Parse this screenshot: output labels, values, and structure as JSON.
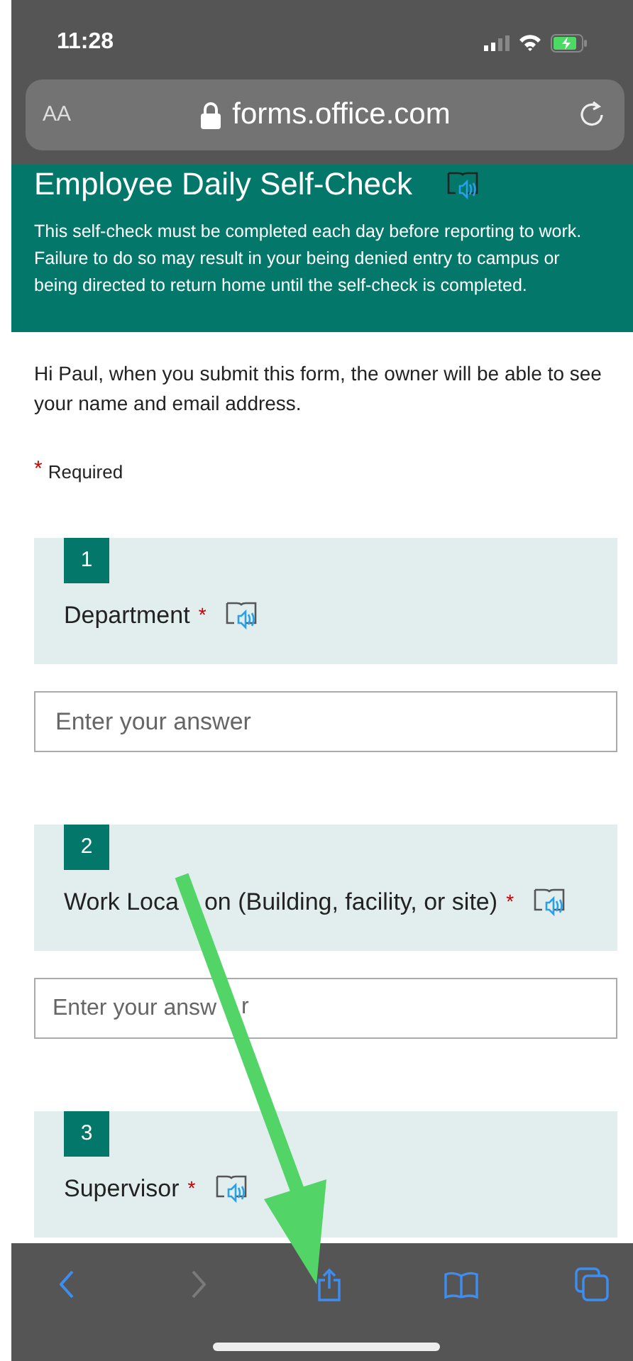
{
  "status_bar": {
    "time": "11:28"
  },
  "address_bar": {
    "text_size_label": "AA",
    "url": "forms.office.com"
  },
  "form": {
    "title": "Employee Daily Self-Check",
    "description": "This self-check must be completed each day before reporting to work. Failure to do so may result in your being denied entry to campus or being directed to return home until the self-check is completed.",
    "notice": "Hi Paul, when you submit this form, the owner will be able to see your name and email address.",
    "required_mark": "*",
    "required_label": "Required",
    "questions": [
      {
        "number": "1",
        "label": "Department",
        "required": true,
        "placeholder": "Enter your answer"
      },
      {
        "number": "2",
        "label_parts": [
          "Work Loca",
          "on (Building, facility, or site)"
        ],
        "required": true,
        "placeholder": "Enter your answ",
        "placeholder_tail": "r"
      },
      {
        "number": "3",
        "label": "Supervisor",
        "required": true
      }
    ]
  },
  "toolbar": [
    {
      "kind": "back",
      "disabled": false
    },
    {
      "kind": "forward",
      "disabled": true
    },
    {
      "kind": "share",
      "disabled": false
    },
    {
      "kind": "bookmarks",
      "disabled": false
    },
    {
      "kind": "tabs",
      "disabled": false
    }
  ]
}
